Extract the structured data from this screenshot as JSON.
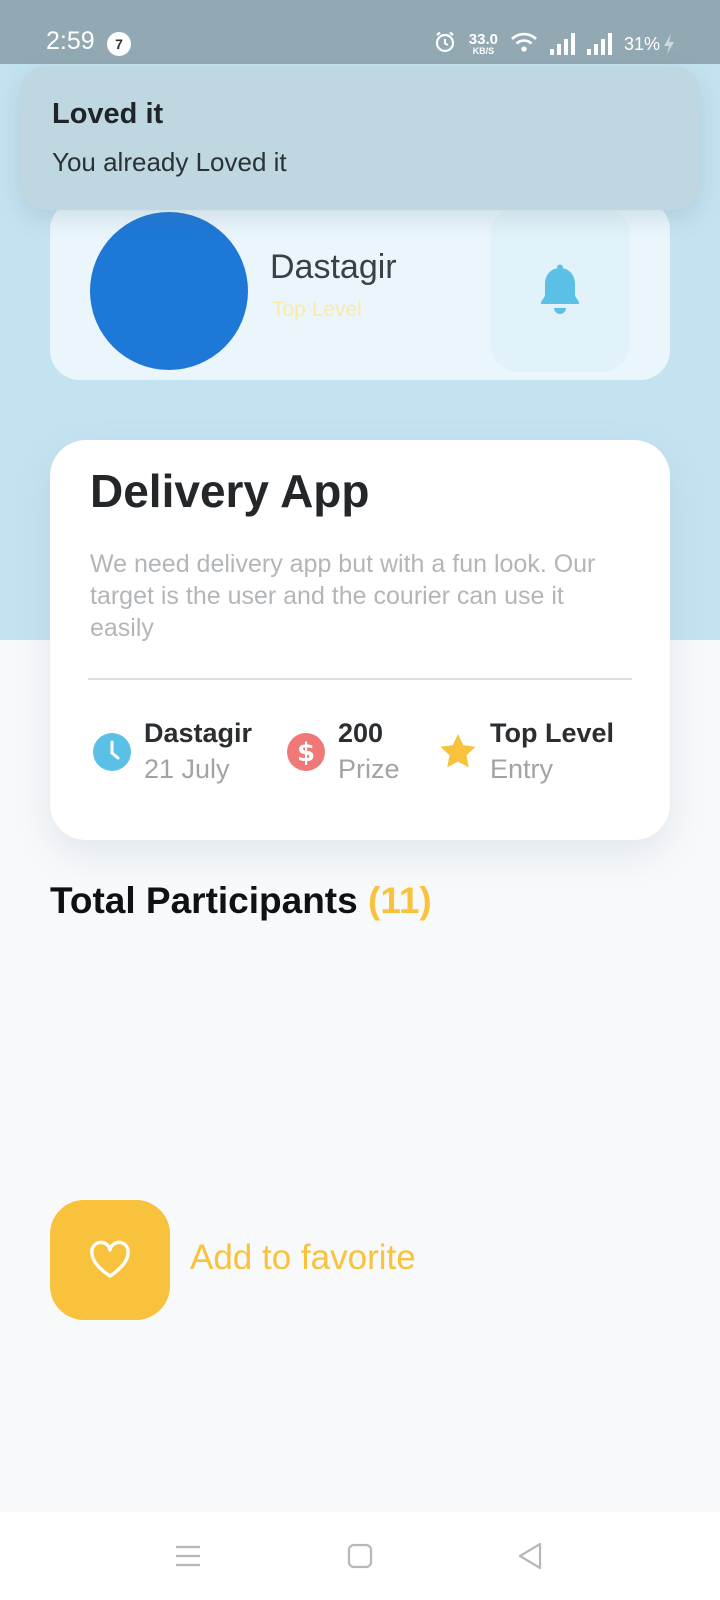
{
  "status_bar": {
    "time": "2:59",
    "notification_count": "7",
    "speed_value": "33.0",
    "speed_unit": "KB/S",
    "battery": "31%"
  },
  "toast": {
    "title": "Loved it",
    "message": "You already Loved it"
  },
  "profile": {
    "name": "Dastagir",
    "level": "Top Level",
    "avatar_color": "#1e78d7"
  },
  "project": {
    "title": "Delivery App",
    "description": "We need delivery app but with a fun look. Our target is the user and the courier can use it easily",
    "stats": [
      {
        "icon": "clock-icon",
        "main": "Dastagir",
        "sub": "21 July",
        "color": "#5bc0e5"
      },
      {
        "icon": "dollar-icon",
        "main": "200",
        "sub": "Prize",
        "color": "#f07878"
      },
      {
        "icon": "star-icon",
        "main": "Top Level",
        "sub": "Entry",
        "color": "#f9c23c"
      }
    ]
  },
  "participants": {
    "label": "Total Participants",
    "count": "(11)"
  },
  "favorite": {
    "label": "Add to favorite"
  },
  "colors": {
    "accent_yellow": "#f9c23c",
    "header_blue": "#c4e3f1",
    "bell_blue": "#5bc0e5"
  }
}
